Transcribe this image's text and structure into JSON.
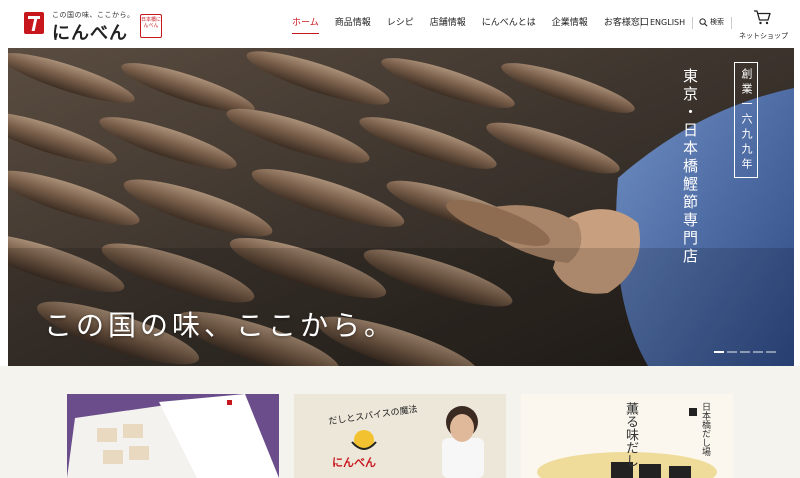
{
  "header": {
    "tagline": "この国の味、ここから。",
    "brand_name": "にんべん",
    "seal_text": "日本橋にんべん",
    "nav": [
      {
        "label": "ホーム",
        "active": true
      },
      {
        "label": "商品情報",
        "active": false
      },
      {
        "label": "レシピ",
        "active": false
      },
      {
        "label": "店舗情報",
        "active": false
      },
      {
        "label": "にんべんとは",
        "active": false
      },
      {
        "label": "企業情報",
        "active": false
      },
      {
        "label": "お客様窓口",
        "active": false
      }
    ],
    "language_label": "ENGLISH",
    "search_label": "検索",
    "cart_label": "ネットショップ"
  },
  "hero": {
    "headline": "この国の味、ここから。",
    "vertical_title": "東京・日本橋鰹節専門店",
    "since_text": "創業一六九九年",
    "slides": 5,
    "active_slide": 1
  },
  "cards": [
    {
      "image": "gift-box-product"
    },
    {
      "image": "spice-campaign",
      "text": "だしとスパイスの魔法",
      "logo": "にんべん"
    },
    {
      "image": "kaoru-aji-dashi",
      "headline": "薫る味だし",
      "side_text": "日本橋だし場"
    }
  ],
  "colors": {
    "accent": "#c8161d",
    "hero_bg": "#3a3530",
    "lower_bg": "#f5f3ee"
  }
}
